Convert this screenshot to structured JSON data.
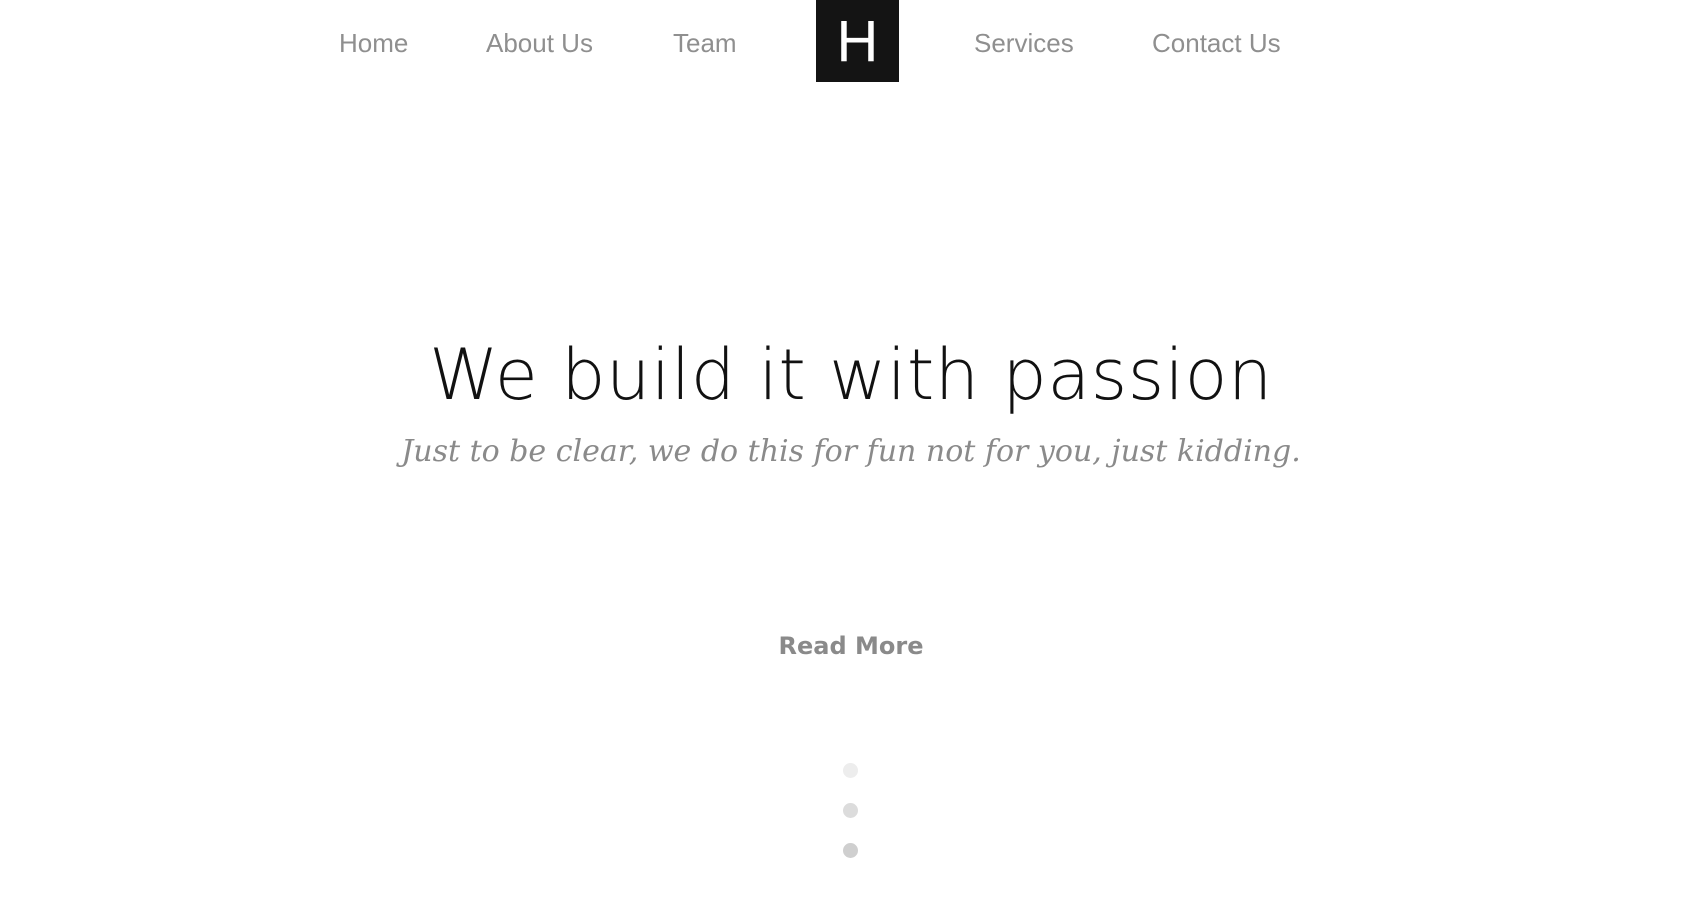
{
  "nav": {
    "left": [
      {
        "label": "Home"
      },
      {
        "label": "About Us"
      },
      {
        "label": "Team"
      }
    ],
    "logo_letter": "H",
    "right": [
      {
        "label": "Services"
      },
      {
        "label": "Contact Us"
      }
    ]
  },
  "hero": {
    "title": "We build it with passion",
    "subtitle": "Just to be clear, we do this for fun not for you, just kidding.",
    "cta_label": "Read More"
  },
  "colors": {
    "nav_text": "#8f8f8f",
    "logo_bg": "#141414",
    "title_text": "#111111",
    "subtitle_text": "#8a8a8a"
  }
}
